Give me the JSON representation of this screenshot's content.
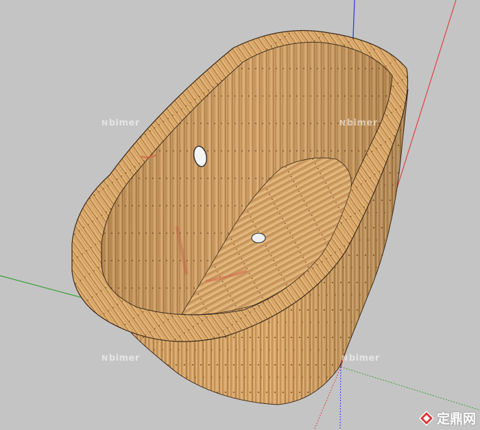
{
  "watermark": {
    "mark_glyph": "N",
    "text": "bimer"
  },
  "logo": {
    "text": "定鼎网",
    "mark_icon": "diamond-logo-icon"
  },
  "colors": {
    "background": "#c4c4c4",
    "axis_blue": "#2a2aff",
    "axis_red": "#e04040",
    "axis_green": "#3aa03a",
    "wood_light": "#e0b074",
    "wood_mid": "#c9955a",
    "wood_dark": "#a87440",
    "edge": "#3a2a1a"
  }
}
